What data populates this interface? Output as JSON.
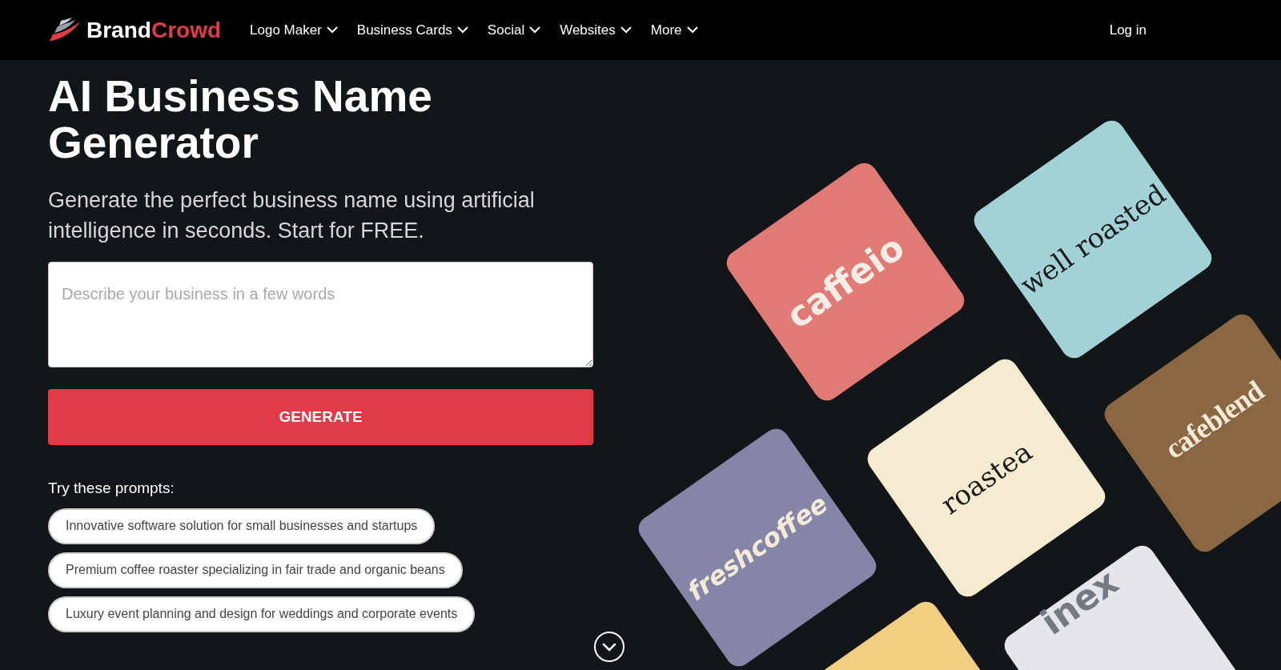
{
  "nav": {
    "logo": {
      "first": "Brand",
      "second": "Crowd"
    },
    "menu": [
      {
        "label": "Logo Maker"
      },
      {
        "label": "Business Cards"
      },
      {
        "label": "Social"
      },
      {
        "label": "Websites"
      },
      {
        "label": "More"
      }
    ],
    "login": "Log in"
  },
  "hero": {
    "title": "AI Business Name Generator",
    "subtitle": "Generate the perfect business name using artificial intelligence in seconds. Start for FREE.",
    "input": {
      "placeholder": "Describe your business in a few words"
    },
    "button": "GENERATE",
    "prompts_label": "Try these prompts:",
    "prompts": [
      "Innovative software solution for small businesses and startups",
      "Premium coffee roaster specializing in fair trade and organic beans",
      "Luxury event planning and design for weddings and corporate events"
    ]
  },
  "cards": [
    {
      "text": "caffeio",
      "kind": "bold",
      "color": "#e07a74"
    },
    {
      "text": "well roasted",
      "kind": "serif",
      "color": "#a2d2d6"
    },
    {
      "text": "cafeblend",
      "kind": "condensed",
      "color": "#8a6642"
    },
    {
      "text": "roastea",
      "kind": "serif",
      "color": "#f5ebd0"
    },
    {
      "text": "freshcoffee",
      "kind": "italic",
      "color": "#8585a8"
    },
    {
      "kind": "blank",
      "color": "#f2cf80"
    },
    {
      "text": "inex",
      "kind": "gray",
      "color": "#e6e5ea"
    }
  ]
}
